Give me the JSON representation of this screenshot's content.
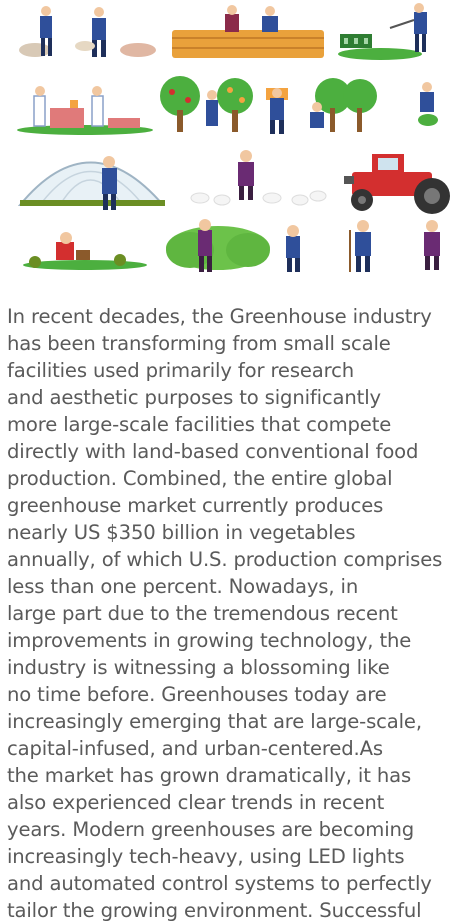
{
  "illustration": {
    "icon": "farming-illustration-collage",
    "colors": {
      "green": "#4caf3f",
      "dark_green": "#2e7d32",
      "blue": "#2f4f9a",
      "brown": "#8b5a2b",
      "red": "#d32f2f",
      "straw": "#e9a13b",
      "purple": "#6a2b73"
    }
  },
  "article": {
    "body": "In recent decades, the Greenhouse industry\nhas been transforming from small scale\nfacilities used primarily for research\nand aesthetic purposes to significantly\nmore large-scale facilities that compete\ndirectly with land-based conventional food\nproduction. Combined, the entire global\ngreenhouse market currently produces\nnearly US $350 billion in vegetables\nannually, of which U.S. production comprises\nless than one percent. Nowadays, in\nlarge part due to the tremendous recent\nimprovements in growing technology, the\nindustry is witnessing a blossoming like\nno time before. Greenhouses today are\nincreasingly emerging that are large-scale,\ncapital-infused, and urban-centered.As\nthe market has grown dramatically, it has\nalso experienced clear trends in recent\nyears. Modern greenhouses are becoming\nincreasingly tech-heavy, using LED lights\nand automated control systems to perfectly\ntailor the growing environment. Successful"
  }
}
